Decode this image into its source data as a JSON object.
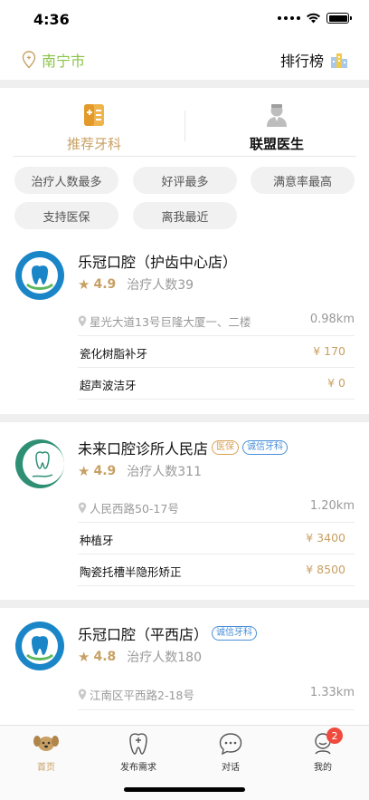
{
  "status_bar": {
    "time": "4:36"
  },
  "header": {
    "city": "南宁市",
    "ranking_label": "排行榜"
  },
  "tabs": [
    {
      "label": "推荐牙科",
      "active": true
    },
    {
      "label": "联盟医生",
      "active": false
    }
  ],
  "filters": [
    "治疗人数最多",
    "好评最多",
    "满意率最高",
    "支持医保",
    "离我最近"
  ],
  "clinics": [
    {
      "name": "乐冠口腔（护齿中心店）",
      "badges": [],
      "rating": "4.9",
      "patients": "治疗人数39",
      "address": "星光大道13号巨隆大厦一、二楼",
      "distance": "0.98km",
      "services": [
        {
          "name": "瓷化树脂补牙",
          "price": "¥ 170"
        },
        {
          "name": "超声波洁牙",
          "price": "¥ 0"
        }
      ]
    },
    {
      "name": "未来口腔诊所人民店",
      "badges": [
        "医保",
        "诚信牙科"
      ],
      "rating": "4.9",
      "patients": "治疗人数311",
      "address": "人民西路50-17号",
      "distance": "1.20km",
      "services": [
        {
          "name": "种植牙",
          "price": "¥ 3400"
        },
        {
          "name": "陶瓷托槽半隐形矫正",
          "price": "¥ 8500"
        }
      ]
    },
    {
      "name": "乐冠口腔（平西店）",
      "badges": [
        "诚信牙科"
      ],
      "rating": "4.8",
      "patients": "治疗人数180",
      "address": "江南区平西路2-18号",
      "distance": "1.33km",
      "services": []
    }
  ],
  "tabbar": [
    {
      "label": "首页",
      "icon": "home-dog-icon",
      "active": true
    },
    {
      "label": "发布需求",
      "icon": "tooth-plus-icon",
      "active": false
    },
    {
      "label": "对话",
      "icon": "chat-bubble-icon",
      "active": false
    },
    {
      "label": "我的",
      "icon": "profile-icon",
      "active": false,
      "badge": "2"
    }
  ],
  "colors": {
    "accent": "#c8a063",
    "city_green": "#8bc34a",
    "badge_red": "#f04a3e",
    "badge_blue": "#4a90d9"
  }
}
